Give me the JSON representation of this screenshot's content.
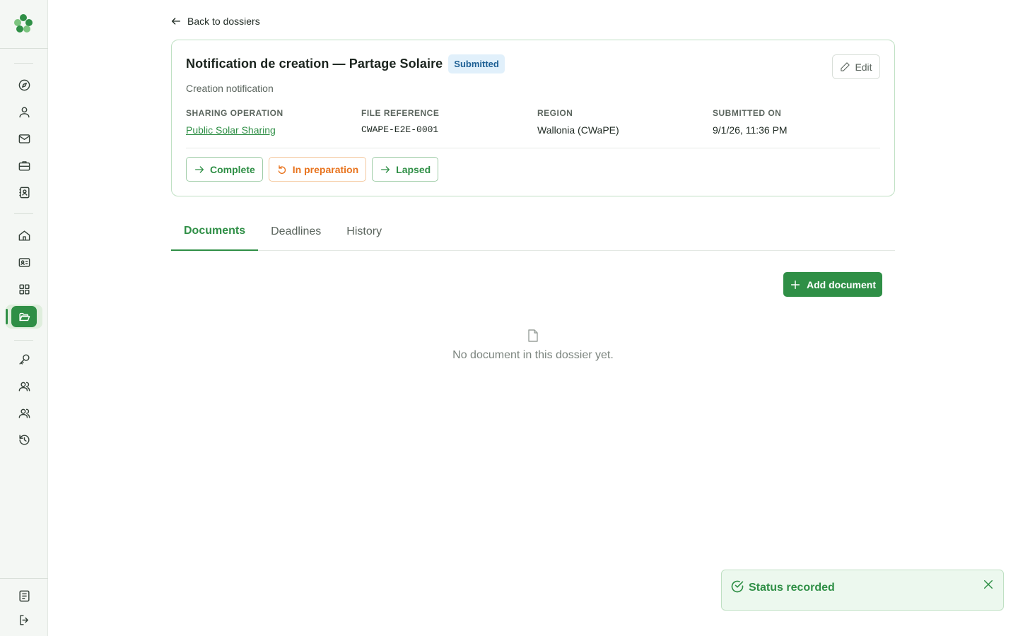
{
  "back_link": {
    "label": "Back to dossiers"
  },
  "dossier": {
    "title": "Notification de creation — Partage Solaire",
    "status_badge": "Submitted",
    "subtitle": "Creation notification",
    "edit_label": "Edit",
    "fields": [
      {
        "label": "SHARING OPERATION",
        "value": "Public Solar Sharing"
      },
      {
        "label": "FILE REFERENCE",
        "value": "CWAPE-E2E-0001"
      },
      {
        "label": "REGION",
        "value": "Wallonia (CWaPE)"
      },
      {
        "label": "SUBMITTED ON",
        "value": "9/1/26, 11:36 PM"
      }
    ],
    "actions": [
      {
        "label": "Complete",
        "icon": "arrow-right-icon",
        "color": "#2f8f46"
      },
      {
        "label": "In preparation",
        "icon": "undo-icon",
        "color": "#e8731d"
      },
      {
        "label": "Lapsed",
        "icon": "arrow-right-icon",
        "color": "#2f8f46"
      }
    ]
  },
  "tabs": [
    {
      "label": "Documents",
      "active": true
    },
    {
      "label": "Deadlines",
      "active": false
    },
    {
      "label": "History",
      "active": false
    }
  ],
  "documents": {
    "add_label": "Add document",
    "empty_text": "No document in this dossier yet."
  },
  "toast": {
    "message": "Status recorded"
  },
  "sidebar": {
    "icons": [
      "compass-icon",
      "user-icon",
      "mail-icon",
      "briefcase-icon",
      "contact-book-icon",
      "home-icon",
      "id-card-icon",
      "grid-icon",
      "folder-open-icon",
      "key-icon",
      "users-icon",
      "users-alt-icon",
      "history-icon",
      "document-icon",
      "logout-icon"
    ],
    "active": "folder-open-icon"
  },
  "colors": {
    "accent": "#2f8f46",
    "badge_bg": "#e1f0fb",
    "badge_text": "#1d5f94",
    "warning": "#e8731d"
  }
}
